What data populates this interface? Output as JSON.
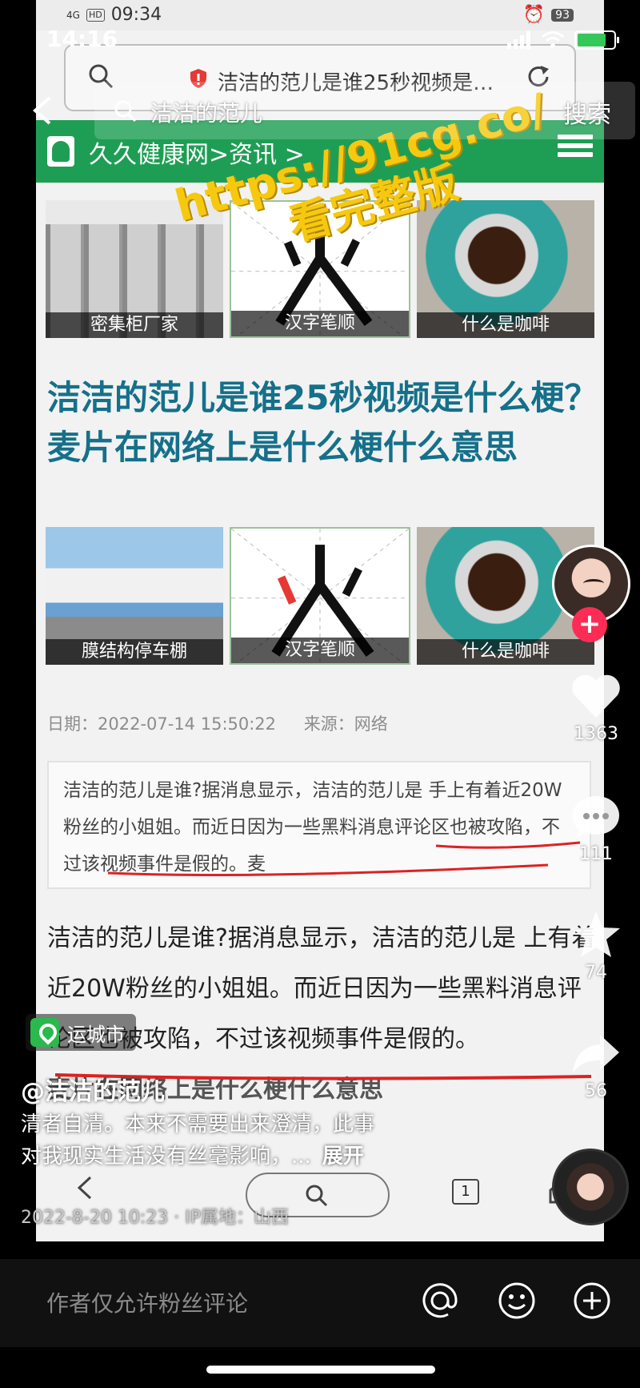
{
  "outer_status": {
    "time": "14:16"
  },
  "top_search": {
    "query": "洁洁的范儿",
    "button": "搜索"
  },
  "video": {
    "status": {
      "network": "4G",
      "hd": "HD",
      "time": "09:34",
      "battery": "93"
    },
    "browser_url": "洁洁的范儿是谁25秒视频是…",
    "site_crumb": "久久健康网>资讯 >",
    "watermark": {
      "line1": "https://91cg.co/",
      "line2": "看完整版"
    },
    "ad_row_1": [
      "密集柜厂家",
      "汉字笔顺",
      "什么是咖啡"
    ],
    "article_title": "洁洁的范儿是谁25秒视频是什么梗？ 麦片在网络上是什么梗什么意思",
    "ad_row_2": [
      "膜结构停车棚",
      "汉字笔顺",
      "什么是咖啡"
    ],
    "meta": {
      "date_label": "日期：",
      "date": "2022-07-14 15:50:22",
      "source_label": "来源：",
      "source": "网络"
    },
    "summary": "洁洁的范儿是谁?据消息显示，洁洁的范儿是  手上有着近20W粉丝的小姐姐。而近日因为一些黑料消息评论区也被攻陷，不过该视频事件是假的。麦",
    "body": "洁洁的范儿是谁?据消息显示，洁洁的范儿是   上有着近20W粉丝的小姐姐。而近日因为一些黑料消息评论区也被攻陷，不过该视频事件是假的。",
    "body_tail": "麦片在网络上是什么梗什么意思",
    "tab_count": "1"
  },
  "rail": {
    "likes": "1363",
    "comments": "111",
    "favorites": "74",
    "shares": "56"
  },
  "location": "运城市",
  "author": "@洁洁的范儿",
  "caption": {
    "line1": "清者自清。本来不需要出来澄清，此事",
    "line2": "对我现实生活没有丝毫影响，...",
    "more": "展开"
  },
  "posted": "2022-8-20 10:23 · IP属地：山西",
  "comment_bar": {
    "placeholder": "作者仅允许粉丝评论"
  },
  "colors": {
    "site_green": "#1e9e54",
    "title_blue": "#15708a",
    "follow_red": "#fe2c55",
    "watermark_yellow": "#f6c90e"
  }
}
